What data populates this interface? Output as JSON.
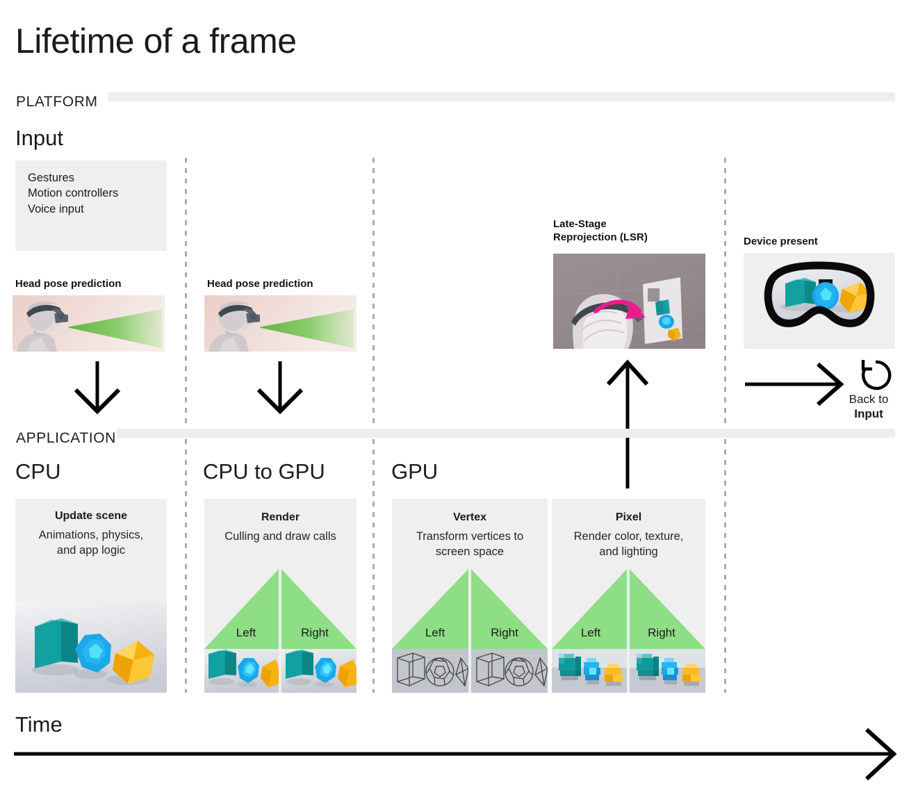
{
  "title": "Lifetime of a frame",
  "bands": {
    "platform": "PLATFORM",
    "application": "APPLICATION"
  },
  "columns": {
    "input": "Input",
    "cpu": "CPU",
    "cpu_to_gpu": "CPU to GPU",
    "gpu": "GPU"
  },
  "input_panel": {
    "items": [
      "Gestures",
      "Motion controllers",
      "Voice input"
    ],
    "text": "Gestures\nMotion controllers\nVoice input"
  },
  "head_pose": {
    "label_1": "Head pose prediction",
    "label_2": "Head pose prediction"
  },
  "lsr": {
    "label": "Late-Stage\nReprojection (LSR)"
  },
  "device_present": {
    "label": "Device present"
  },
  "back_to_input": {
    "line1": "Back to",
    "line2": "Input"
  },
  "stages": {
    "update_scene": {
      "title": "Update scene",
      "subtitle": "Animations, physics,\nand app logic"
    },
    "render": {
      "title": "Render",
      "subtitle": "Culling and draw calls",
      "eyes": [
        "Left",
        "Right"
      ]
    },
    "vertex": {
      "title": "Vertex",
      "subtitle": "Transform vertices to\nscreen space",
      "eyes": [
        "Left",
        "Right"
      ]
    },
    "pixel": {
      "title": "Pixel",
      "subtitle": "Render color, texture,\nand lighting",
      "eyes": [
        "Left",
        "Right"
      ]
    }
  },
  "time_axis": {
    "label": "Time"
  },
  "colors": {
    "panel_grey": "#efefef",
    "band_grey": "#eeeeee",
    "frustum_green": "#8ede86",
    "dash_grey": "#aaaaaa",
    "arrow_black": "#000000",
    "lsr_arrow_magenta": "#ed1a8d",
    "cube_teal": "#13a0a0",
    "sphere_blue": "#1ba7e8",
    "poly_gold": "#f5b211"
  }
}
